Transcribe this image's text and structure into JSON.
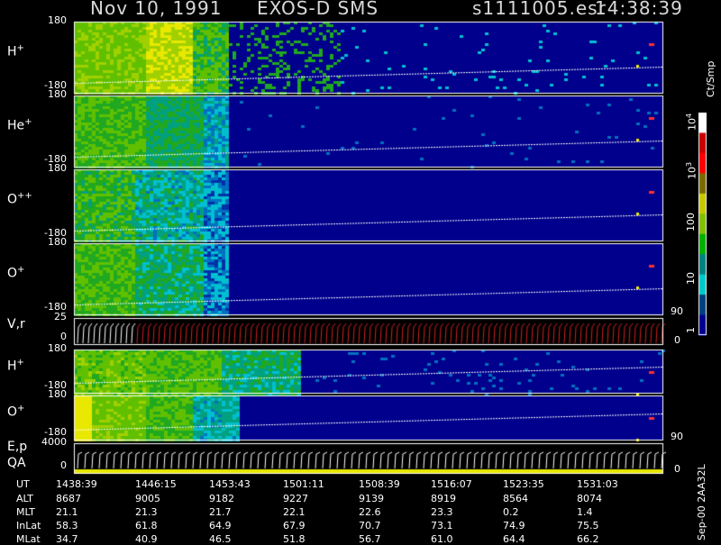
{
  "header": {
    "date": "Nov 10, 1991",
    "instrument": "EXOS-D SMS",
    "file": "s1111005.esr",
    "time": "14:38:39"
  },
  "panels": [
    {
      "label": "H",
      "sup": "+",
      "ytop": "180",
      "ybot": "-180",
      "kind": "spec",
      "profile": "H"
    },
    {
      "label": "He",
      "sup": "+",
      "ytop": "180",
      "ybot": "-180",
      "kind": "spec",
      "profile": "He"
    },
    {
      "label": "O",
      "sup": "++",
      "ytop": "180",
      "ybot": "-180",
      "kind": "spec",
      "profile": "O2"
    },
    {
      "label": "O",
      "sup": "+",
      "ytop": "180",
      "ybot": "-180",
      "kind": "spec",
      "profile": "O"
    },
    {
      "label": "V,r",
      "sup": "",
      "ytop": "25",
      "ybot": "0",
      "right_top": "90",
      "right_bot": "0",
      "kind": "ticks"
    },
    {
      "label": "H",
      "sup": "+",
      "ytop": "180",
      "ybot": "-180",
      "kind": "spec",
      "profile": "H2"
    },
    {
      "label": "O",
      "sup": "+",
      "ytop": "180",
      "ybot": "-180",
      "kind": "spec",
      "profile": "O3"
    },
    {
      "label": "E,p",
      "label2": "QA",
      "sup": "",
      "ytop": "4000",
      "ybot": "0",
      "right_top": "90",
      "right_bot": "0",
      "kind": "ticks2"
    }
  ],
  "colorbar": {
    "unit": "Ct/Smp",
    "labels": [
      {
        "text": "10",
        "sup": "4"
      },
      {
        "text": "10",
        "sup": "3"
      },
      {
        "text": "100",
        "sup": ""
      },
      {
        "text": "10",
        "sup": ""
      },
      {
        "text": "1",
        "sup": ""
      }
    ],
    "colors": [
      "#ffffff",
      "#c80000",
      "#ff0000",
      "#7a6a00",
      "#c8c800",
      "#80c000",
      "#00b000",
      "#008080",
      "#00c8c8",
      "#004080",
      "#000090"
    ]
  },
  "orbit_table": {
    "row_labels": [
      "UT",
      "ALT",
      "MLT",
      "InLat",
      "MLat"
    ],
    "columns": [
      {
        "UT": "1438:39",
        "ALT": "8687",
        "MLT": "21.1",
        "InLat": "58.3",
        "MLat": "34.7"
      },
      {
        "UT": "1446:15",
        "ALT": "9005",
        "MLT": "21.3",
        "InLat": "61.8",
        "MLat": "40.9"
      },
      {
        "UT": "1453:43",
        "ALT": "9182",
        "MLT": "21.7",
        "InLat": "64.9",
        "MLat": "46.5"
      },
      {
        "UT": "1501:11",
        "ALT": "9227",
        "MLT": "22.1",
        "InLat": "67.9",
        "MLat": "51.8"
      },
      {
        "UT": "1508:39",
        "ALT": "9139",
        "MLT": "22.6",
        "InLat": "70.7",
        "MLat": "56.7"
      },
      {
        "UT": "1516:07",
        "ALT": "8919",
        "MLT": "23.3",
        "InLat": "73.1",
        "MLat": "61.0"
      },
      {
        "UT": "1523:35",
        "ALT": "8564",
        "MLT": "0.2",
        "InLat": "74.9",
        "MLat": "64.4"
      },
      {
        "UT": "1531:03",
        "ALT": "8074",
        "MLT": "1.4",
        "InLat": "75.5",
        "MLat": "66.2"
      }
    ]
  },
  "footer": {
    "stamp": "Sep-00 2AA32L"
  },
  "chart_data": {
    "type": "heatmap",
    "title": "Nov 10, 1991 EXOS-D SMS s1111005.esr 14:38:39",
    "x": [
      "1438:39",
      "1446:15",
      "1453:43",
      "1501:11",
      "1508:39",
      "1516:07",
      "1523:35",
      "1531:03"
    ],
    "xlabel": "UT",
    "series": [
      {
        "name": "H+",
        "ylim": [
          -180,
          180
        ]
      },
      {
        "name": "He+",
        "ylim": [
          -180,
          180
        ]
      },
      {
        "name": "O++",
        "ylim": [
          -180,
          180
        ]
      },
      {
        "name": "O+",
        "ylim": [
          -180,
          180
        ]
      },
      {
        "name": "V,r",
        "ylim": [
          0,
          25
        ]
      },
      {
        "name": "H+",
        "ylim": [
          -180,
          180
        ]
      },
      {
        "name": "O+",
        "ylim": [
          -180,
          180
        ]
      },
      {
        "name": "E,p",
        "ylim": [
          0,
          4000
        ]
      }
    ],
    "colorscale_unit": "Ct/Smp",
    "colorscale_range": [
      1,
      10000
    ]
  }
}
